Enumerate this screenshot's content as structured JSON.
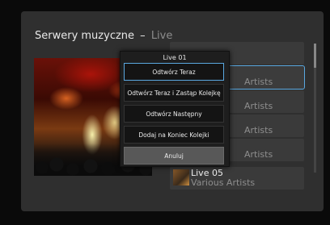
{
  "header": {
    "title": "Serwery muzyczne",
    "separator": "–",
    "subtitle": "Live"
  },
  "list": {
    "items": [
      {
        "title": "",
        "artist": ""
      },
      {
        "title": "",
        "artist": "Artists"
      },
      {
        "title": "",
        "artist": "Artists"
      },
      {
        "title": "",
        "artist": "Artists"
      },
      {
        "title": "",
        "artist": "Artists"
      },
      {
        "title": "Live 05",
        "artist": "Various Artists"
      }
    ],
    "selected_index": 1
  },
  "popup": {
    "title": "Live 01",
    "buttons": [
      "Odtwórz Teraz",
      "Odtwórz Teraz i Zastąp Kolejkę",
      "Odtwórz Następny",
      "Dodaj na Koniec Kolejki",
      "Anuluj"
    ]
  },
  "colors": {
    "focus": "#5aa8e0",
    "background": "#2f2f2f",
    "subtitle": "#8c8c8c"
  }
}
